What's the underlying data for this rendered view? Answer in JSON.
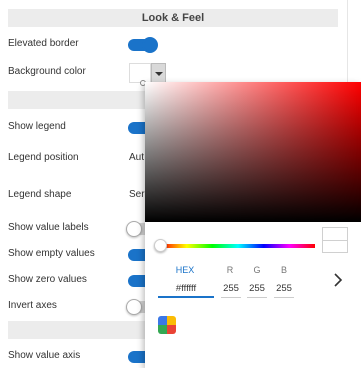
{
  "section_look_feel": "Look & Feel",
  "rows": {
    "elevated_border": {
      "label": "Elevated border",
      "on": true
    },
    "background_color": {
      "label": "Background color",
      "value_color": "#ffffff"
    },
    "show_legend": {
      "label": "Show legend",
      "on": true
    },
    "legend_position": {
      "label": "Legend position",
      "value": "Aut"
    },
    "legend_shape": {
      "label": "Legend shape",
      "value": "Seri"
    },
    "show_value_labels": {
      "label": "Show value labels",
      "on": false
    },
    "show_empty_values": {
      "label": "Show empty values",
      "on": true
    },
    "show_zero_values": {
      "label": "Show zero values",
      "on": true
    },
    "invert_axes": {
      "label": "Invert axes",
      "on": false
    },
    "show_value_axis": {
      "label": "Show value axis",
      "on": true
    }
  },
  "picker": {
    "hue_color": "#ff0000",
    "hex_label": "HEX",
    "hex_value": "#ffffff",
    "r_label": "R",
    "r_value": "255",
    "g_label": "G",
    "g_value": "255",
    "b_label": "B",
    "b_value": "255",
    "next_icon": "chevron-right-icon",
    "palette_icon": "palette-icon"
  },
  "colors": {
    "accent": "#1a73c9",
    "section_bg": "#ececec"
  }
}
